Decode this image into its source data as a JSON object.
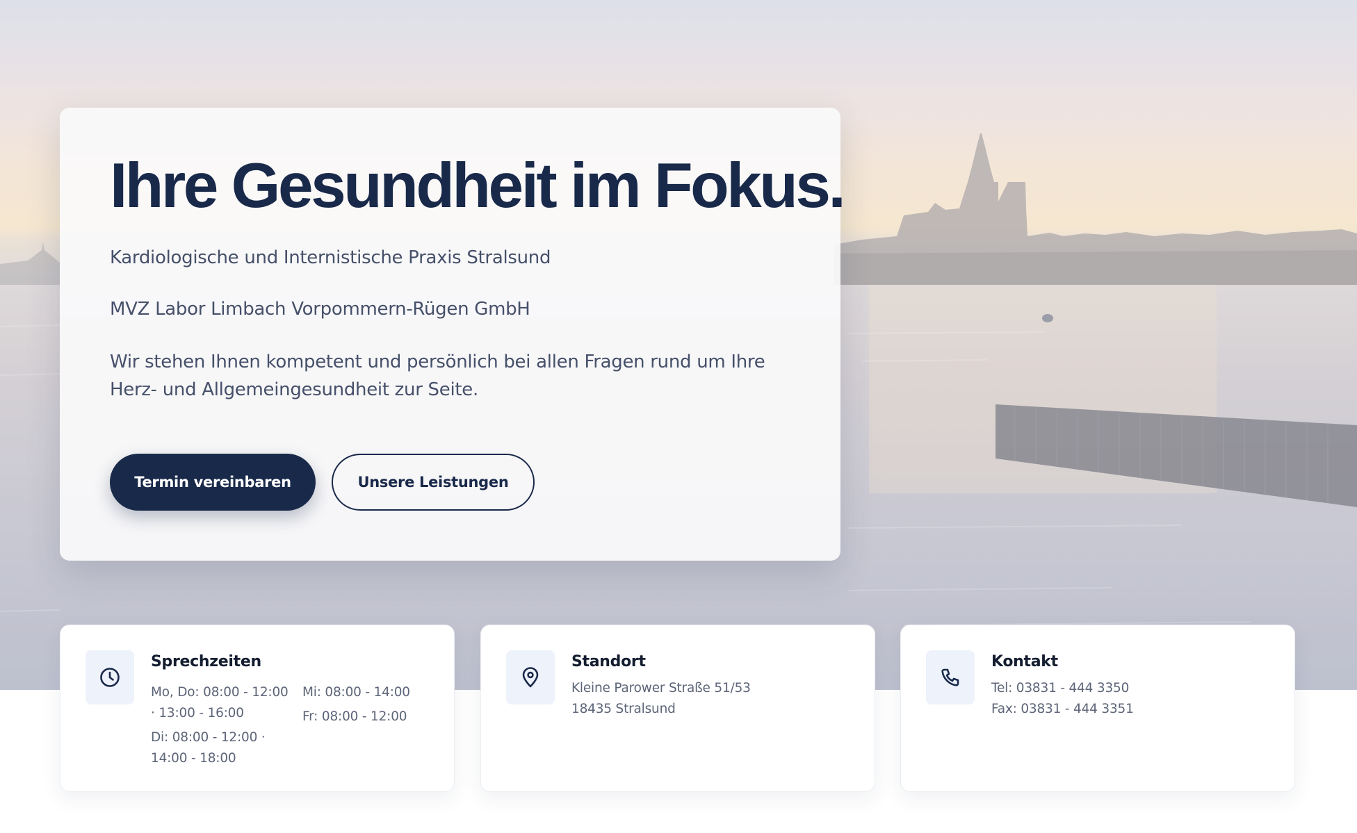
{
  "hero": {
    "title": "Ihre Gesundheit im Fokus.",
    "subtitle": "Kardiologische und Internistische Praxis Stralsund",
    "company": "MVZ Labor Limbach Vorpommern-Rügen GmbH",
    "description": "Wir stehen Ihnen kompetent und persönlich bei allen Fragen rund um Ihre Herz- und Allgemeingesundheit zur Seite.",
    "primary_button": "Termin vereinbaren",
    "secondary_button": "Unsere Leistungen"
  },
  "cards": {
    "hours": {
      "icon": "clock-icon",
      "title": "Sprechzeiten",
      "mon_thu": "Mo, Do: 08:00 - 12:00 · 13:00 - 16:00",
      "tue": "Di: 08:00 - 12:00 · 14:00 - 18:00",
      "wed": "Mi: 08:00 - 14:00",
      "fri": "Fr: 08:00 - 12:00"
    },
    "location": {
      "icon": "location-pin-icon",
      "title": "Standort",
      "street": "Kleine Parower Straße 51/53",
      "city": "18435 Stralsund"
    },
    "contact": {
      "icon": "phone-icon",
      "title": "Kontakt",
      "tel": "Tel: 03831 - 444 3350",
      "fax": "Fax: 03831 - 444 3351"
    }
  },
  "colors": {
    "navy": "#19294a",
    "text_muted": "#46506a",
    "icon_bg": "#eef2fb"
  }
}
